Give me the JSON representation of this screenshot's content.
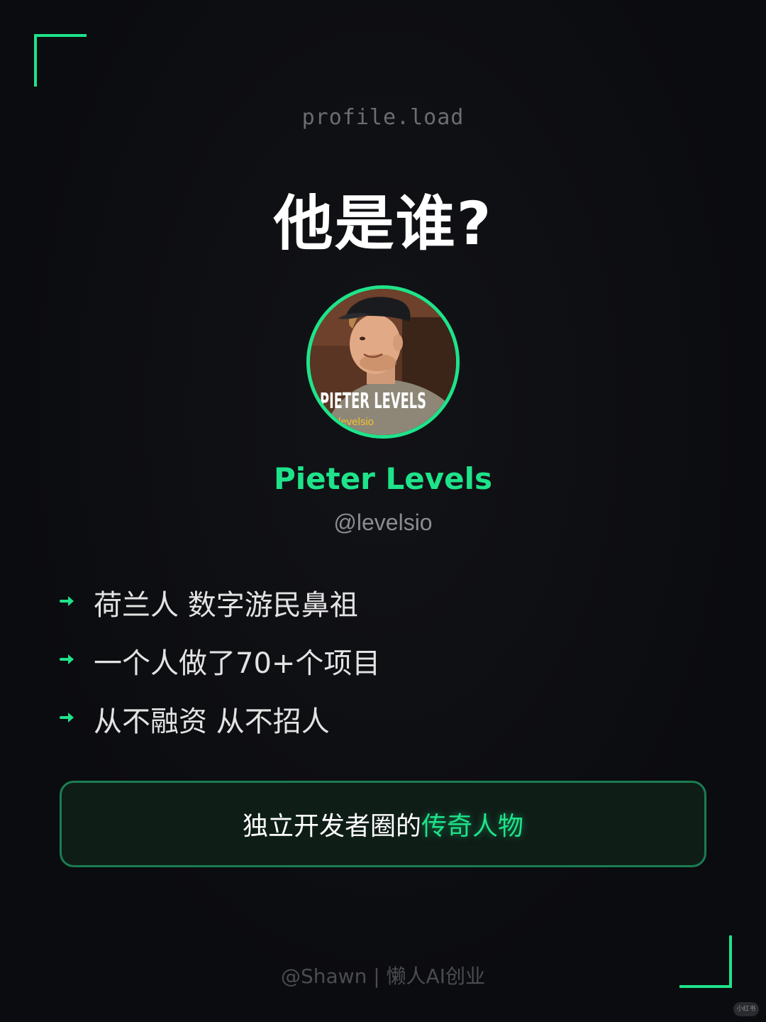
{
  "loader_text": "profile.load",
  "title": "他是谁?",
  "avatar": {
    "overlay_name": "PIETER LEVELS",
    "overlay_handle": "levelsio"
  },
  "profile": {
    "name": "Pieter Levels",
    "handle": "@levelsio"
  },
  "facts": [
    "荷兰人 数字游民鼻祖",
    "一个人做了70+个项目",
    "从不融资 从不招人"
  ],
  "callout": {
    "prefix": "独立开发者圈的",
    "highlight": "传奇人物"
  },
  "footer": "@Shawn | 懒人AI创业",
  "watermark": "小红书",
  "colors": {
    "accent": "#1ee38a",
    "background": "#0c0d10",
    "text": "#e3e3e3"
  },
  "icons": {
    "bullet": "arrow-right-icon"
  }
}
